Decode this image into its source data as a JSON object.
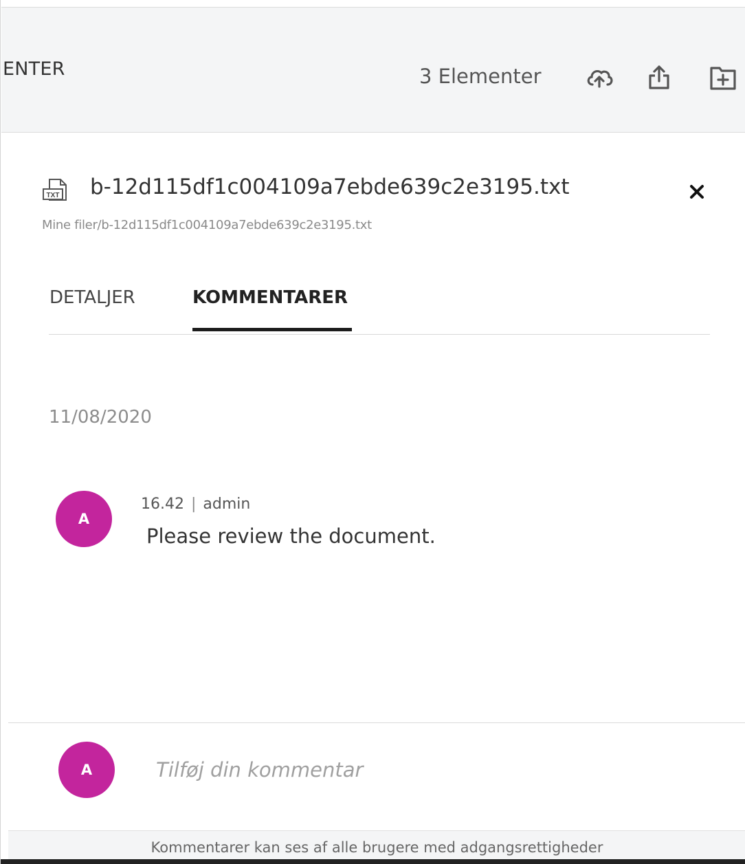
{
  "toolbar": {
    "breadcrumb": "ENTER",
    "item_count": "3 Elementer",
    "icons": [
      "cloud-upload-icon",
      "share-icon",
      "new-folder-icon"
    ]
  },
  "file": {
    "name": "b-12d115df1c004109a7ebde639c2e3195.txt",
    "path": "Mine filer/b-12d115df1c004109a7ebde639c2e3195.txt",
    "type_badge": "TXT"
  },
  "tabs": [
    {
      "label": "DETALJER",
      "active": false
    },
    {
      "label": "KOMMENTARER",
      "active": true
    }
  ],
  "comments": {
    "date_group": "11/08/2020",
    "items": [
      {
        "avatar_initial": "A",
        "time": "16.42",
        "author": "admin",
        "text": "Please review the document."
      }
    ],
    "input": {
      "avatar_initial": "A",
      "placeholder": "Tilføj din kommentar"
    },
    "footer_note": "Kommentarer kan ses af alle brugere med adgangsrettigheder"
  },
  "colors": {
    "avatar": "#c3259d",
    "toolbar_bg": "#f4f5f6",
    "active_tab_underline": "#1c1c1c"
  }
}
